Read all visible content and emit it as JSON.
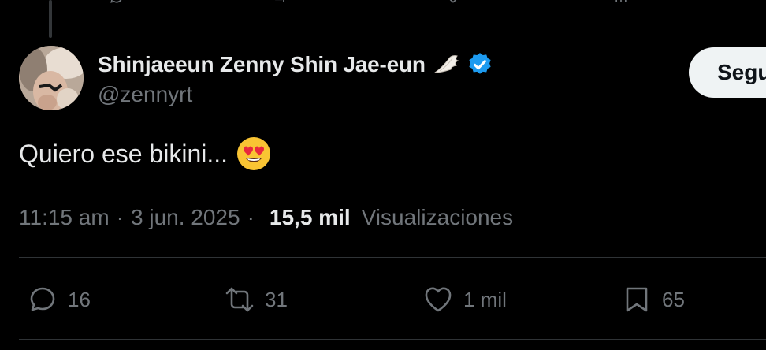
{
  "author": {
    "display_name": "Shinjaeeun Zenny Shin Jae-eun",
    "handle": "@zennyrt",
    "verified": true
  },
  "follow_button": {
    "label": "Segu"
  },
  "tweet": {
    "text": "Quiero ese bikini..."
  },
  "meta": {
    "time": "11:15 am",
    "separator": "·",
    "date": "3 jun. 2025",
    "views_count": "15,5 mil",
    "views_label": "Visualizaciones"
  },
  "actions": {
    "replies": "16",
    "reposts": "31",
    "likes": "1 mil",
    "bookmarks": "65"
  },
  "icons": {
    "verified": "verified-badge-icon",
    "wing": "wing-icon",
    "emoji": "heart-eyes-emoji-icon",
    "reply": "reply-icon",
    "repost": "repost-icon",
    "like": "heart-icon",
    "bookmark": "bookmark-icon"
  },
  "colors": {
    "background": "#000000",
    "text": "#e7e9ea",
    "muted": "#71767b",
    "verified_blue": "#1d9bf0",
    "divider": "#2f3336",
    "follow_bg": "#eff3f4"
  }
}
